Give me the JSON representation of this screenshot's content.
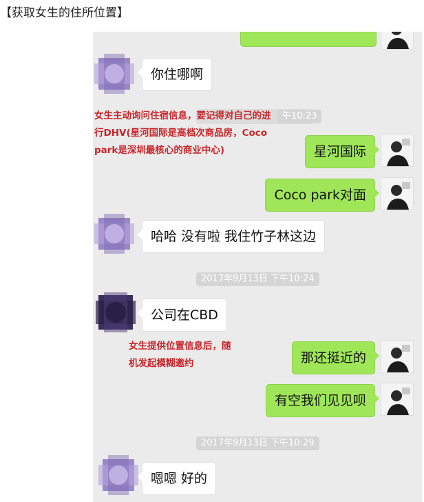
{
  "page": {
    "title": "【获取女生的住所位置】"
  },
  "chat": {
    "messages": [
      {
        "side": "left",
        "text": "你住哪啊"
      },
      {
        "side": "right",
        "text": "星河国际"
      },
      {
        "side": "right",
        "text": "Coco park对面"
      },
      {
        "side": "left",
        "text": "哈哈 没有啦 我住竹子林这边"
      },
      {
        "side": "left",
        "text": "公司在CBD"
      },
      {
        "side": "right",
        "text": "那还挺近的"
      },
      {
        "side": "right",
        "text": "有空我们见见呗"
      },
      {
        "side": "left",
        "text": "嗯嗯 好的"
      }
    ],
    "timestamps": [
      {
        "text": "午10:23"
      },
      {
        "text": "2017年9月13日 下午10:24"
      },
      {
        "text": "2017年9月13日 下午10:29"
      }
    ]
  },
  "notes": [
    {
      "lines": [
        "女生主动询问住宿信息，要记得对自己的进",
        "行DHV(星河国际是高档次商品房，Coco",
        "park是深圳最核心的商业中心)"
      ]
    },
    {
      "lines": [
        "女生提供位置信息后，随",
        "机发起模糊邀约"
      ]
    }
  ],
  "colors": {
    "chat_bg": "#ebebeb",
    "bubble_green": "#9fe658",
    "bubble_white": "#ffffff",
    "note_red": "#c9252a",
    "time_bg": "#d5d5d5"
  },
  "icons": {
    "left_avatar": "purple-blurred-avatar",
    "right_avatar": "man-photo-avatar"
  }
}
